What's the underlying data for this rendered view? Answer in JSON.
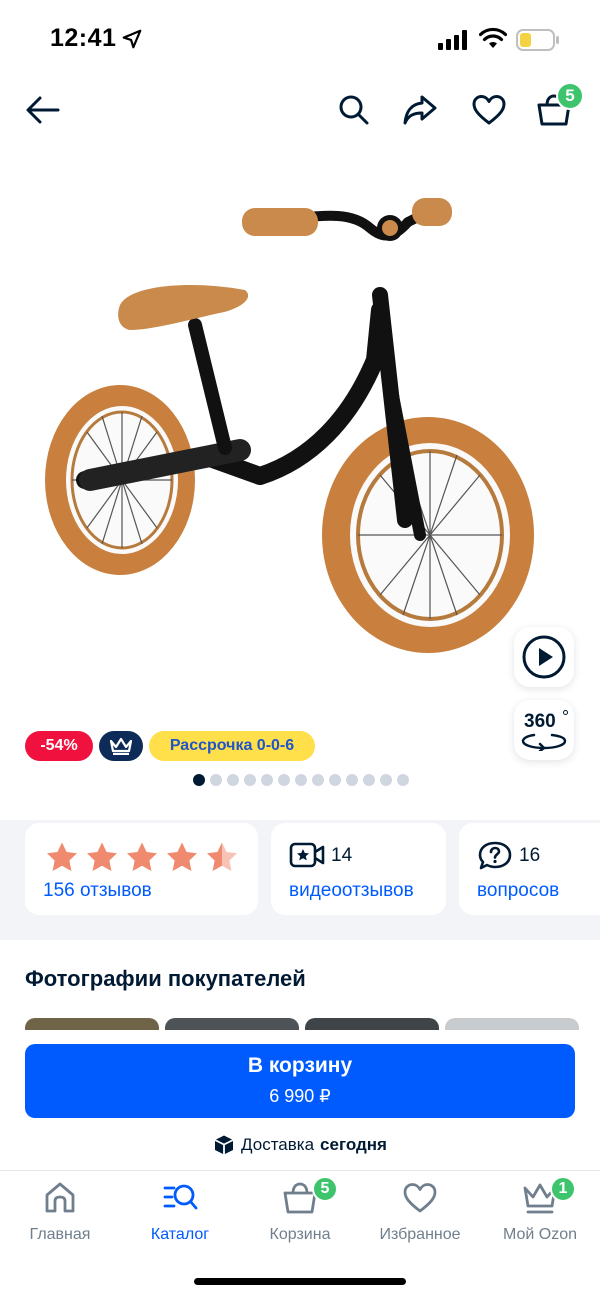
{
  "status_bar": {
    "time": "12:41"
  },
  "header": {
    "cart_count": "5"
  },
  "product": {
    "badges": {
      "discount": "-54%",
      "installment": "Рассрочка 0-0-6"
    },
    "gallery_total": 13,
    "gallery_active": 1,
    "view360_label": "360"
  },
  "info": {
    "rating_stars": 4.5,
    "reviews_label": "156 отзывов",
    "video_count": "14",
    "video_label": "видеоотзывов",
    "questions_count": "16",
    "questions_label": "вопросов"
  },
  "customer_photos": {
    "title": "Фотографии покупателей"
  },
  "cta": {
    "label": "В корзину",
    "price": "6 990 ₽"
  },
  "delivery": {
    "prefix": "Доставка",
    "emphasis": "сегодня"
  },
  "tabbar": {
    "items": [
      {
        "label": "Главная",
        "icon": "home-icon"
      },
      {
        "label": "Каталог",
        "icon": "catalog-search-icon"
      },
      {
        "label": "Корзина",
        "icon": "basket-icon",
        "badge": "5"
      },
      {
        "label": "Избранное",
        "icon": "heart-icon"
      },
      {
        "label": "Мой Ozon",
        "icon": "crown-icon",
        "badge": "1"
      }
    ]
  },
  "colors": {
    "accent": "#005bff",
    "discount": "#f1113f",
    "badge_green": "#3ec46d",
    "installment_yellow": "#ffdf4a",
    "star": "#f08a6e"
  }
}
